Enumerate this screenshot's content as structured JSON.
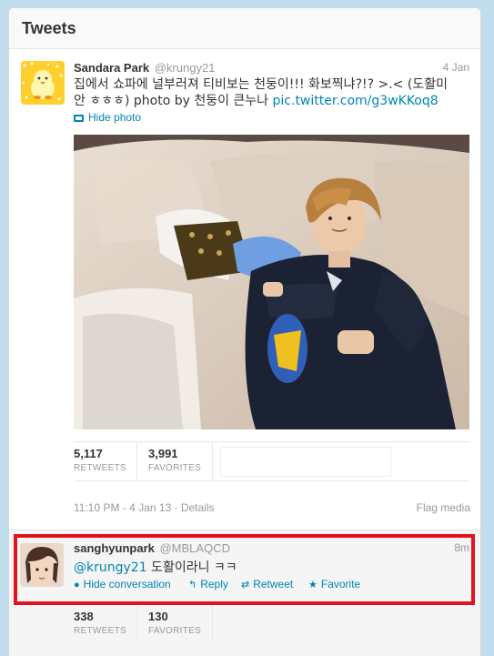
{
  "panel": {
    "title": "Tweets"
  },
  "tweet1": {
    "fullname": "Sandara Park",
    "screenname": "@krungy21",
    "time": "4 Jan",
    "text_line1": "집에서 쇼파에 널부러져 티비보는 천둥이!!! 화보찍냐?!? >.< (도활미",
    "text_line2_prefix": "안 ㅎㅎㅎ) photo by 천둥이 큰누나 ",
    "text_link": "pic.twitter.com/g3wKKoq8",
    "hide_photo": "Hide photo",
    "retweets_count": "5,117",
    "retweets_label": "RETWEETS",
    "favorites_count": "3,991",
    "favorites_label": "FAVORITES",
    "timestamp": "11:10 PM - 4 Jan 13 · Details",
    "flag_media": "Flag media"
  },
  "tweet2": {
    "fullname": "sanghyunpark",
    "screenname": "@MBLAQCD",
    "time": "8m",
    "mention": "@krungy21",
    "text": " 도활이라니 ㅋㅋ",
    "actions": {
      "hide_conversation": "Hide conversation",
      "reply": "Reply",
      "retweet": "Retweet",
      "favorite": "Favorite"
    },
    "retweets_count": "338",
    "retweets_label": "RETWEETS",
    "favorites_count": "130",
    "favorites_label": "FAVORITES"
  },
  "colors": {
    "link": "#0084b4",
    "highlight_border": "#e0141e",
    "background": "#c0deed"
  },
  "icons": [
    "photo-icon",
    "speech-bubble-icon",
    "reply-arrow-icon",
    "retweet-icon",
    "star-icon"
  ]
}
